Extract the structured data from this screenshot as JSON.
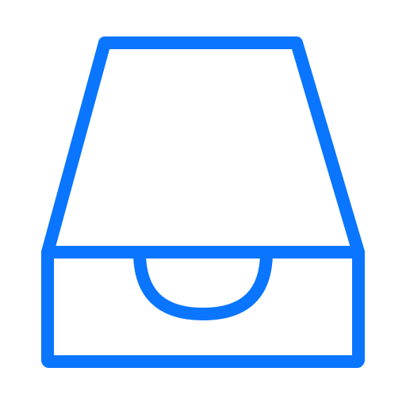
{
  "icon": {
    "name": "inbox-tray-icon",
    "color": "#0a76ff"
  }
}
